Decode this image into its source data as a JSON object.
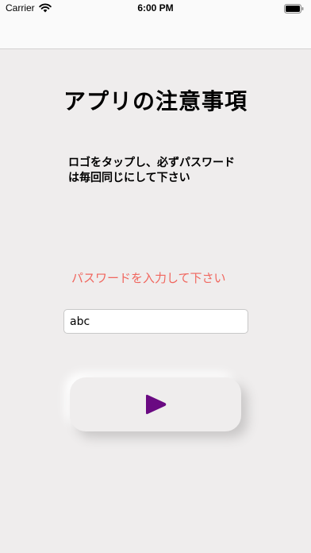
{
  "status_bar": {
    "carrier": "Carrier",
    "time": "6:00 PM"
  },
  "main": {
    "title": "アプリの注意事項",
    "notice_line1": "ロゴをタップし、必ずパスワード",
    "notice_line2": "は毎回同じにして下さい",
    "prompt": "パスワードを入力して下さい",
    "password_value": "abc"
  },
  "icons": {
    "wifi": "wifi-icon",
    "battery": "battery-icon",
    "play": "play-icon"
  },
  "colors": {
    "background": "#efeded",
    "prompt_text": "#f0665e",
    "play_icon": "#6a0a82"
  }
}
